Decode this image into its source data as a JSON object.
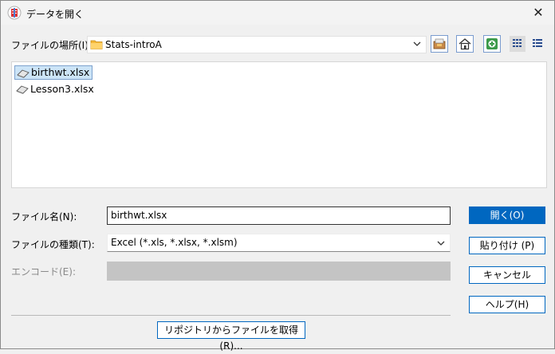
{
  "window": {
    "title": "データを開く",
    "close_glyph": "✕"
  },
  "location": {
    "label": "ファイルの場所(I):",
    "current": "Stats-introA"
  },
  "toolbar": {
    "icons": [
      "up-folder-icon",
      "home-icon",
      "new-folder-icon",
      "list-view-icon",
      "details-view-icon"
    ]
  },
  "files": [
    {
      "name": "birthwt.xlsx",
      "selected": true
    },
    {
      "name": "Lesson3.xlsx",
      "selected": false
    }
  ],
  "filename": {
    "label": "ファイル名(N):",
    "value": "birthwt.xlsx"
  },
  "filetype": {
    "label": "ファイルの種類(T):",
    "value": "Excel (*.xls, *.xlsx, *.xlsm)"
  },
  "encoding": {
    "label": "エンコード(E):",
    "value": ""
  },
  "buttons": {
    "open": "開く(O)",
    "paste": "貼り付け (P)",
    "cancel": "キャンセル",
    "help": "ヘルプ(H)",
    "repository": "リポジトリからファイルを取得(R)..."
  },
  "colors": {
    "accent": "#0067c0",
    "selection": "#cce4f7"
  }
}
